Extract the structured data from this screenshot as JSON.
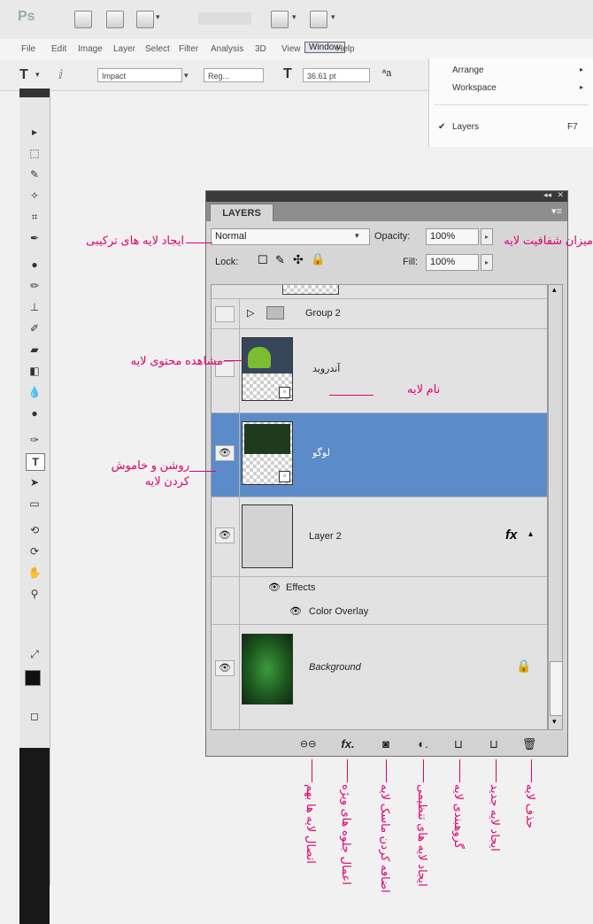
{
  "menubar": {
    "items": [
      "File",
      "Edit",
      "Image",
      "Layer",
      "Select",
      "Filter",
      "Analysis",
      "3D",
      "View",
      "Window",
      "Help"
    ]
  },
  "options": {
    "font_family": "Impact",
    "font_style": "Reg...",
    "font_size": "36.61 pt"
  },
  "window_menu": {
    "items": [
      "Arrange",
      "Workspace",
      "Layers"
    ],
    "layers_shortcut": "F7"
  },
  "panel": {
    "tab": "LAYERS",
    "blend_mode": "Normal",
    "opacity_label": "Opacity:",
    "opacity_value": "100%",
    "lock_label": "Lock:",
    "fill_label": "Fill:",
    "fill_value": "100%"
  },
  "layers": {
    "group": "Group 2",
    "android": "آندروید",
    "logo": "لوگو",
    "layer2": "Layer 2",
    "layer2_fx": "fx",
    "effects": "Effects",
    "color_overlay": "Color Overlay",
    "background": "Background"
  },
  "annotations": {
    "blend": "ایجاد لایه های ترکیبی",
    "opacity": "میزان شفافیت لایه",
    "thumbnail": "مشاهده محتوی لایه",
    "name": "نام لایه",
    "visibility_1": "روشن و خاموش",
    "visibility_2": "کردن لایه",
    "link": "اتصال لایه ها بهم",
    "fx": "اعمال جلوه های ویژه",
    "mask": "اضافه کردن ماسک لایه",
    "adjustment": "ایجاد لایه های تنظیمی",
    "group": "گروهبندی لایه",
    "new_layer": "ایجاد لایه جدید",
    "delete": "حذف لایه"
  },
  "colors": {
    "annotation": "#e0006e",
    "selected_row": "#5b8bc9"
  }
}
